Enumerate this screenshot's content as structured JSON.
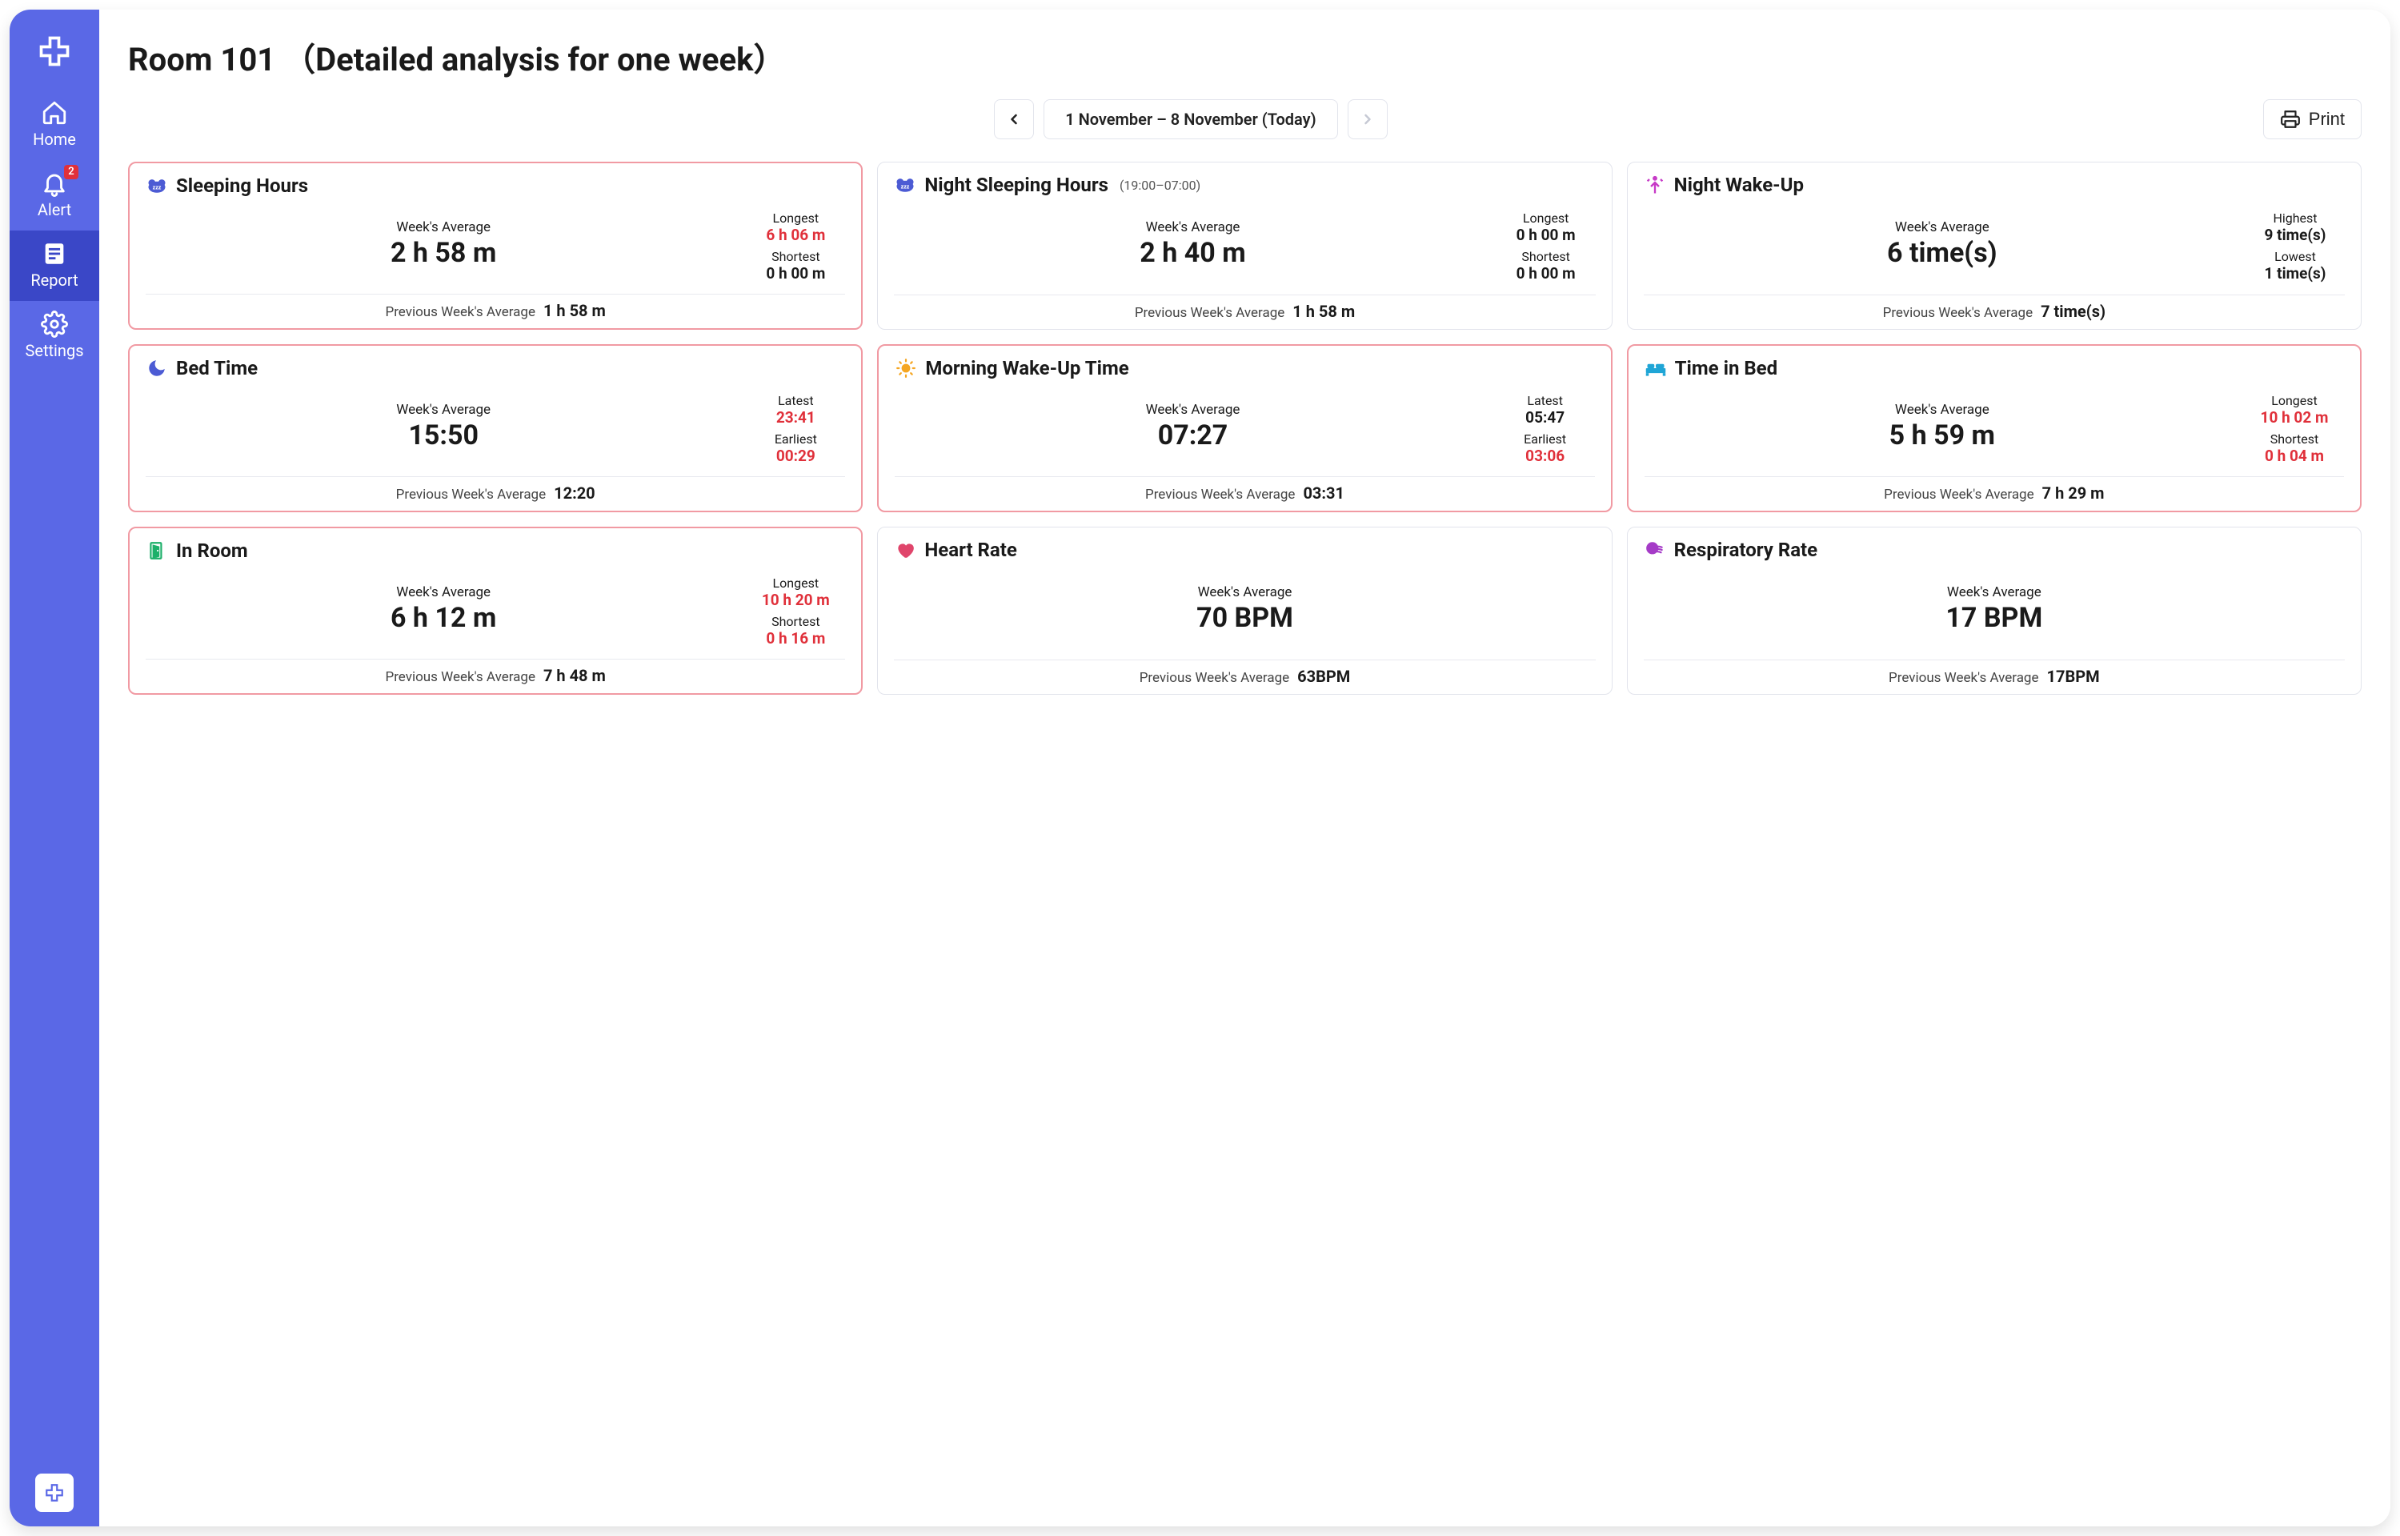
{
  "sidebar": {
    "items": [
      {
        "label": "Home"
      },
      {
        "label": "Alert",
        "badge": "2"
      },
      {
        "label": "Report"
      },
      {
        "label": "Settings"
      }
    ]
  },
  "header": {
    "title": "Room 101 （Detailed analysis for one week）",
    "date_range": "1 November – 8 November (Today)",
    "print_label": "Print"
  },
  "labels": {
    "week_avg": "Week's Average",
    "prev_week_avg": "Previous Week's Average",
    "longest": "Longest",
    "shortest": "Shortest",
    "latest": "Latest",
    "earliest": "Earliest",
    "highest": "Highest",
    "lowest": "Lowest"
  },
  "cards": {
    "sleeping_hours": {
      "title": "Sleeping Hours",
      "avg": "2 h 58 m",
      "longest": "6 h 06 m",
      "shortest": "0 h 00 m",
      "prev": "1 h 58 m"
    },
    "night_sleeping_hours": {
      "title": "Night Sleeping Hours",
      "subtitle": "(19:00–07:00)",
      "avg": "2 h 40 m",
      "longest": "0 h 00 m",
      "shortest": "0 h 00 m",
      "prev": "1 h 58 m"
    },
    "night_wake_up": {
      "title": "Night Wake-Up",
      "avg": "6 time(s)",
      "highest": "9 time(s)",
      "lowest": "1 time(s)",
      "prev": "7 time(s)"
    },
    "bed_time": {
      "title": "Bed Time",
      "avg": "15:50",
      "latest": "23:41",
      "earliest": "00:29",
      "prev": "12:20"
    },
    "morning_wake_up": {
      "title": "Morning Wake-Up Time",
      "avg": "07:27",
      "latest": "05:47",
      "earliest": "03:06",
      "prev": "03:31"
    },
    "time_in_bed": {
      "title": "Time in Bed",
      "avg": "5 h 59 m",
      "longest": "10 h 02 m",
      "shortest": "0 h 04 m",
      "prev": "7 h 29 m"
    },
    "in_room": {
      "title": "In Room",
      "avg": "6 h 12 m",
      "longest": "10 h 20 m",
      "shortest": "0 h 16 m",
      "prev": "7 h 48 m"
    },
    "heart_rate": {
      "title": "Heart Rate",
      "avg": "70 BPM",
      "prev": "63BPM"
    },
    "respiratory_rate": {
      "title": "Respiratory Rate",
      "avg": "17 BPM",
      "prev": "17BPM"
    }
  },
  "colors": {
    "sidebar_bg": "#5A68E6",
    "sidebar_active": "#3A47C7",
    "alert_border": "#F19AA3",
    "warn_text": "#E0303A",
    "icon_sleep": "#4C5BD4",
    "icon_wakeup": "#C73BC7",
    "icon_moon": "#4C5BD4",
    "icon_sun": "#F5A623",
    "icon_bed": "#1FA5D6",
    "icon_door": "#1DB06A",
    "icon_heart": "#E0456B",
    "icon_resp": "#A53BC7"
  }
}
